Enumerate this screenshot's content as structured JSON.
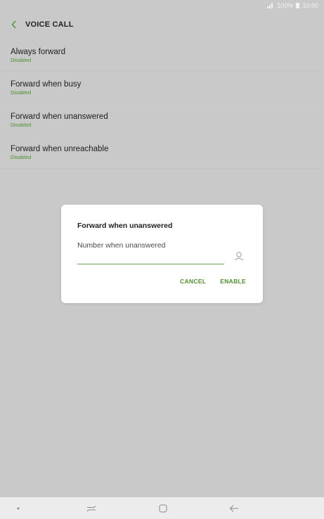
{
  "status_bar": {
    "battery_text": "100%",
    "time": "10:00",
    "icons": [
      "signal-icon",
      "battery-icon"
    ]
  },
  "header": {
    "title": "VOICE CALL",
    "back_icon": "chevron-left-icon"
  },
  "settings": {
    "items": [
      {
        "label": "Always forward",
        "status": "Disabled"
      },
      {
        "label": "Forward when busy",
        "status": "Disabled"
      },
      {
        "label": "Forward when unanswered",
        "status": "Disabled"
      },
      {
        "label": "Forward when unreachable",
        "status": "Disabled"
      }
    ]
  },
  "dialog": {
    "title": "Forward when unanswered",
    "input_placeholder": "Number when unanswered",
    "input_value": "",
    "contacts_icon": "contact-person-icon",
    "cancel_label": "CANCEL",
    "enable_label": "ENABLE"
  },
  "nav_bar": {
    "icons": [
      "dot-icon",
      "recent-apps-icon",
      "home-icon",
      "back-arrow-icon"
    ]
  },
  "colors": {
    "accent": "#4f8f2f",
    "background": "#c9c9c9",
    "dialog": "#ffffff",
    "nav_bar": "#ececec"
  }
}
